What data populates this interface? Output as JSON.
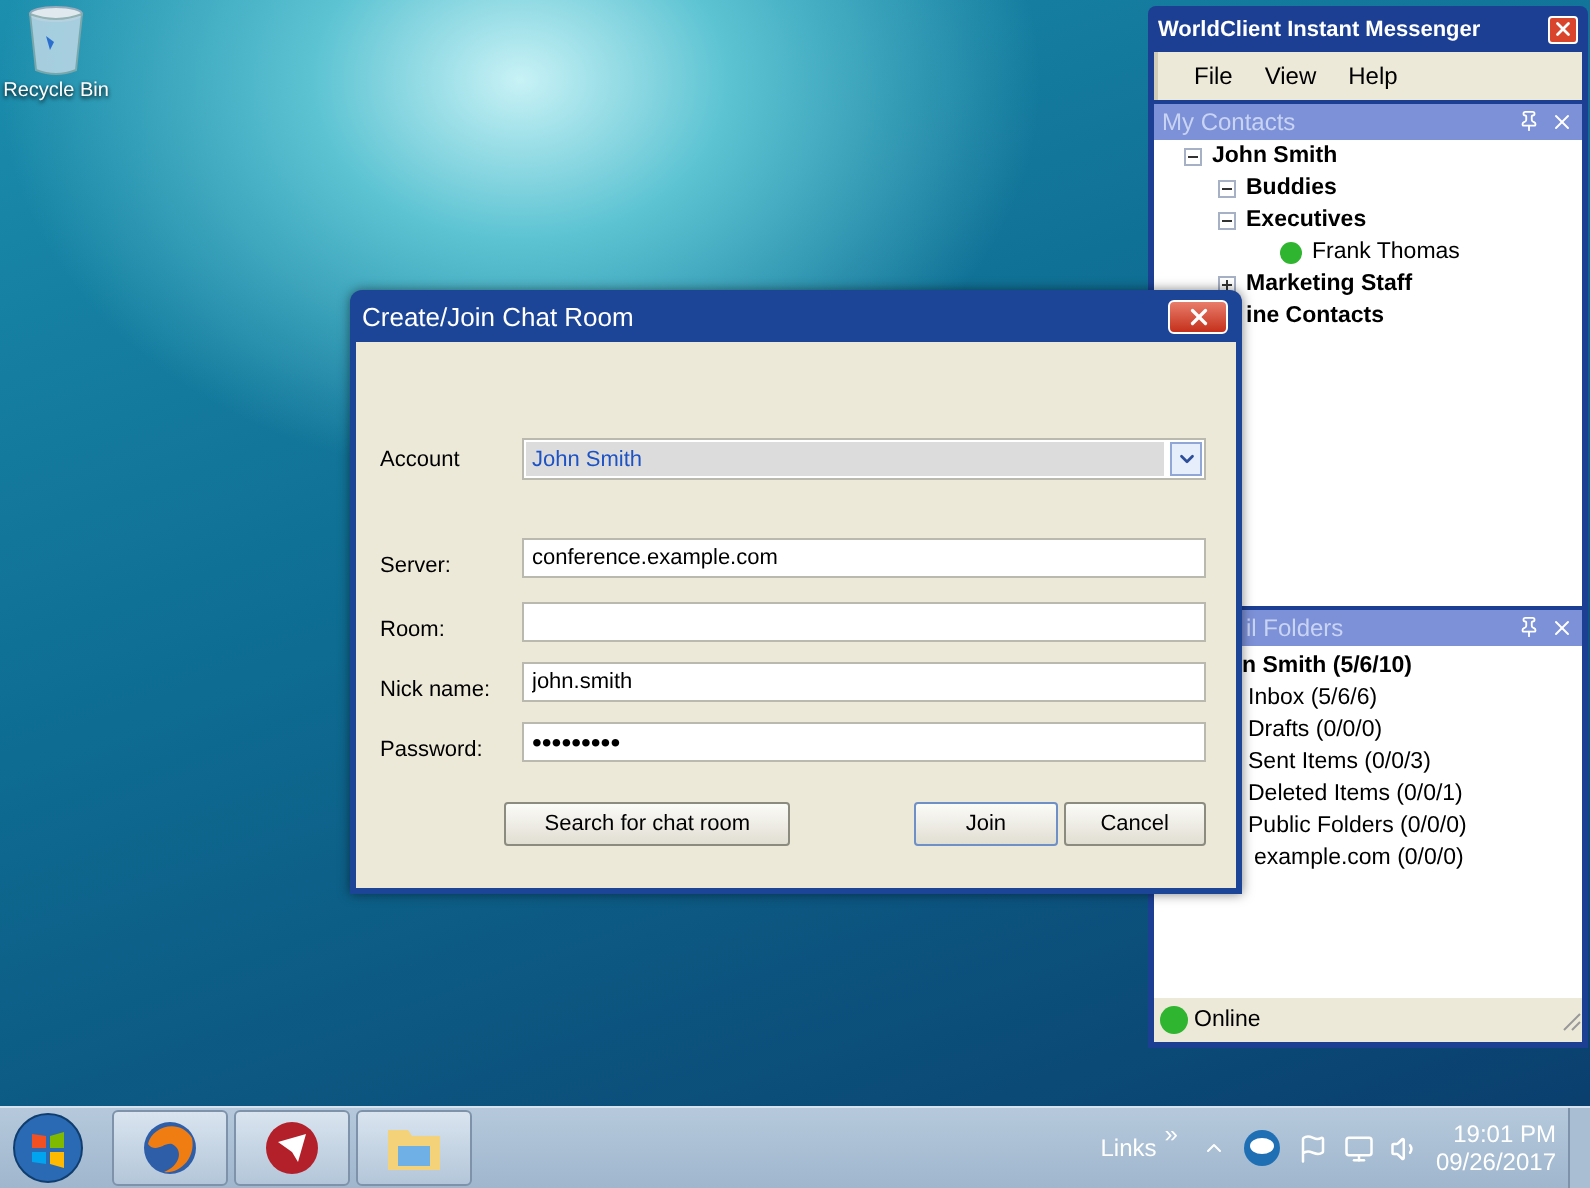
{
  "desktop_icons": [
    {
      "label": "Recycle Bin"
    }
  ],
  "messenger": {
    "title": "WorldClient Instant Messenger",
    "menu": [
      "File",
      "View",
      "Help"
    ],
    "contacts_panel": {
      "title": "My Contacts",
      "tree": [
        {
          "label": "John Smith",
          "expanded": true,
          "children": [
            {
              "label": "Buddies",
              "expanded": true
            },
            {
              "label": "Executives",
              "expanded": true,
              "children": [
                {
                  "label": "Frank Thomas",
                  "kind": "contact",
                  "color": "#2fb52f"
                }
              ]
            },
            {
              "label": "Marketing Staff",
              "expanded": false
            },
            {
              "label": "ine Contacts"
            }
          ]
        }
      ]
    },
    "folders_panel": {
      "title": "il Folders",
      "tree": [
        {
          "label": "n Smith (5/6/10)",
          "children": [
            {
              "label": "Inbox (5/6/6)"
            },
            {
              "label": "Drafts (0/0/0)"
            },
            {
              "label": "Sent Items (0/0/3)"
            },
            {
              "label": "Deleted Items (0/0/1)"
            },
            {
              "label": "Public Folders (0/0/0)",
              "children": [
                {
                  "label": "example.com (0/0/0)"
                }
              ]
            }
          ]
        }
      ]
    },
    "status": {
      "label": "Online",
      "color": "#2fb52f"
    }
  },
  "dialog": {
    "title": "Create/Join Chat Room",
    "fields": [
      {
        "label": "Account",
        "kind": "combo",
        "value": "John Smith"
      },
      {
        "label": "Server:",
        "kind": "text",
        "value": "conference.example.com"
      },
      {
        "label": "Room:",
        "kind": "text"
      },
      {
        "label": "Nick name:",
        "kind": "text",
        "value": "john.smith"
      },
      {
        "label": "Password:",
        "kind": "password",
        "value": "•••••••••"
      }
    ],
    "buttons": [
      {
        "label": "Search for chat room",
        "default": false
      },
      {
        "label": "Join",
        "default": true
      },
      {
        "label": "Cancel",
        "default": false
      }
    ]
  },
  "taskbar": {
    "links": "Links",
    "chevron": "»",
    "time": "19:01 PM",
    "date": "09/26/2017"
  }
}
